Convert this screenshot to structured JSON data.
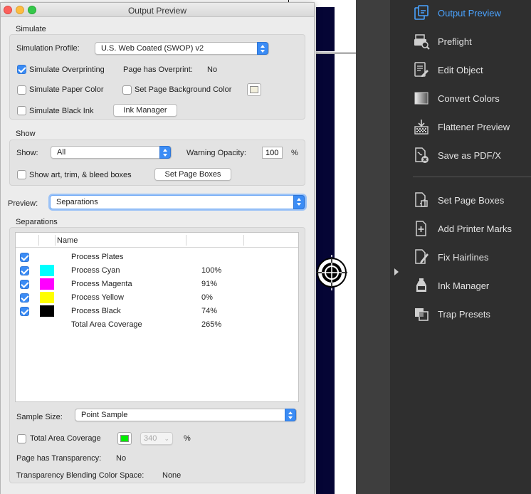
{
  "dialog": {
    "title": "Output Preview",
    "simulate": {
      "section_label": "Simulate",
      "profile_label": "Simulation Profile:",
      "profile_value": "U.S. Web Coated (SWOP) v2",
      "overprinting_label": "Simulate Overprinting",
      "overprinting_checked": true,
      "page_overprint_label": "Page has Overprint:",
      "page_overprint_value": "No",
      "paper_color_label": "Simulate Paper Color",
      "paper_color_checked": false,
      "bg_color_label": "Set Page Background Color",
      "bg_color_checked": false,
      "bg_color_swatch": "#f2efdc",
      "black_ink_label": "Simulate Black Ink",
      "black_ink_checked": false,
      "ink_manager_button": "Ink Manager"
    },
    "show": {
      "section_label": "Show",
      "show_label": "Show:",
      "show_value": "All",
      "warning_opacity_label": "Warning Opacity:",
      "warning_opacity_value": "100",
      "percent_sign": "%",
      "boxes_label": "Show art, trim, & bleed boxes",
      "boxes_checked": false,
      "set_page_boxes_button": "Set Page Boxes"
    },
    "preview": {
      "label": "Preview:",
      "value": "Separations"
    },
    "separations": {
      "section_label": "Separations",
      "columns": [
        "",
        "",
        "Name",
        ""
      ],
      "rows": [
        {
          "checked": true,
          "swatch": "",
          "name": "Process Plates",
          "pct": ""
        },
        {
          "checked": true,
          "swatch": "#00ffff",
          "name": "Process Cyan",
          "pct": "100%"
        },
        {
          "checked": true,
          "swatch": "#ff00ff",
          "name": "Process Magenta",
          "pct": "91%"
        },
        {
          "checked": true,
          "swatch": "#ffff00",
          "name": "Process Yellow",
          "pct": "0%"
        },
        {
          "checked": true,
          "swatch": "#000000",
          "name": "Process Black",
          "pct": "74%"
        },
        {
          "checked": false,
          "swatch": "",
          "name": "Total Area Coverage",
          "pct": "265%"
        }
      ]
    },
    "sample_size": {
      "label": "Sample Size:",
      "value": "Point Sample"
    },
    "tac": {
      "label": "Total Area Coverage",
      "checked": false,
      "swatch": "#00ee00",
      "value": "340",
      "percent_sign": "%"
    },
    "transparency": {
      "label": "Page has Transparency:",
      "value": "No",
      "blend_label": "Transparency Blending Color Space:",
      "blend_value": "None"
    }
  },
  "tools": {
    "items": [
      {
        "label": "Output Preview",
        "icon": "output-preview-icon",
        "active": true
      },
      {
        "label": "Preflight",
        "icon": "preflight-icon",
        "active": false
      },
      {
        "label": "Edit Object",
        "icon": "edit-object-icon",
        "active": false
      },
      {
        "label": "Convert Colors",
        "icon": "convert-colors-icon",
        "active": false
      },
      {
        "label": "Flattener Preview",
        "icon": "flattener-preview-icon",
        "active": false
      },
      {
        "label": "Save as PDF/X",
        "icon": "save-pdfx-icon",
        "active": false
      },
      {
        "label": "Set Page Boxes",
        "icon": "set-page-boxes-icon",
        "active": false
      },
      {
        "label": "Add Printer Marks",
        "icon": "add-printer-marks-icon",
        "active": false
      },
      {
        "label": "Fix Hairlines",
        "icon": "fix-hairlines-icon",
        "active": false
      },
      {
        "label": "Ink Manager",
        "icon": "ink-manager-icon",
        "active": false
      },
      {
        "label": "Trap Presets",
        "icon": "trap-presets-icon",
        "active": false
      }
    ],
    "accent_color": "#4aa3ff"
  }
}
